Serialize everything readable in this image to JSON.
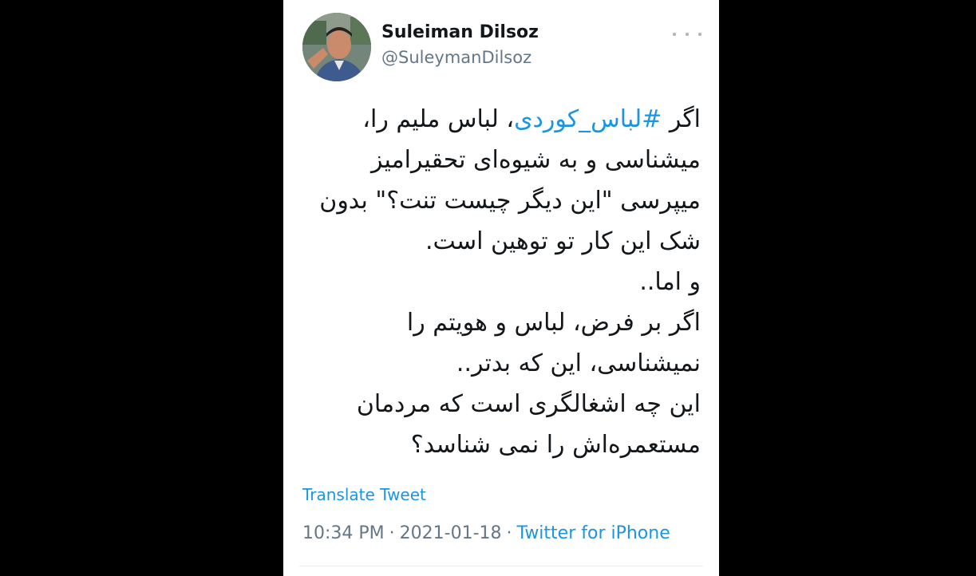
{
  "user": {
    "display_name": "Suleiman Dilsoz",
    "handle": "@SuleymanDilsoz",
    "avatar_icon": "profile-photo"
  },
  "menu": {
    "more_icon": "ellipsis-icon"
  },
  "tweet": {
    "line1_prefix": "اگر ",
    "hashtag": "#لباس_کوردی",
    "line1_suffix": "، لباس ملیم را،",
    "line2": "میشناسی و به شیوه‌ای تحقیرامیز",
    "line3": "میپرسی \"این دیگر چیست تنت؟\" بدون",
    "line4": "شک این کار تو توهین است.",
    "line5": "و اما..",
    "line6": " اگر بر فرض، لباس و هویتم را",
    "line7": "نمیشناسی، این که بدتر..",
    "line8": "این چه اشغالگری است که مردمان",
    "line9": "مستعمره‌اش را نمی شناسد؟"
  },
  "actions": {
    "translate_label": "Translate Tweet"
  },
  "meta": {
    "time": "10:34 PM",
    "separator": "·",
    "date": "2021-01-18",
    "source": "Twitter for iPhone"
  },
  "colors": {
    "link": "#1b95e0",
    "secondary_text": "#657786",
    "primary_text": "#14171a",
    "background": "#000000",
    "card": "#ffffff"
  }
}
